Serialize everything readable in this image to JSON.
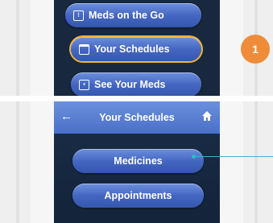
{
  "top_screen": {
    "buttons": [
      {
        "label": "Meds on the Go",
        "icon": "pill-grid-icon"
      },
      {
        "label": "Your Schedules",
        "icon": "calendar-icon"
      },
      {
        "label": "See Your Meds",
        "icon": "image-icon"
      }
    ],
    "selected_index": 1
  },
  "step_badge": "1",
  "bottom_screen": {
    "header": {
      "title": "Your Schedules",
      "back_icon": "arrow-left-icon",
      "home_icon": "home-icon"
    },
    "buttons": [
      {
        "label": "Medicines"
      },
      {
        "label": "Appointments"
      }
    ]
  },
  "colors": {
    "accent_orange": "#ef8c3a",
    "selection_outline": "#f4b43a",
    "button_blue": "#4567c2",
    "callout_line": "#3fb3c7",
    "screen_bg": "#17283f"
  }
}
